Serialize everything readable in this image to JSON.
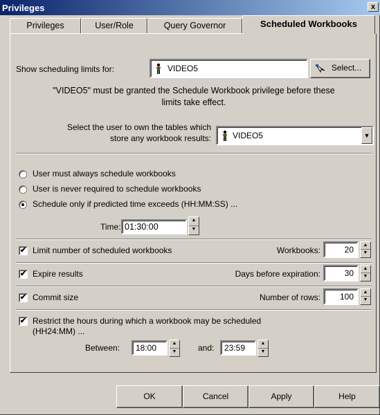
{
  "window": {
    "title": "Privileges",
    "close_glyph": "x"
  },
  "tabs": [
    {
      "label": "Privileges"
    },
    {
      "label": "User/Role"
    },
    {
      "label": "Query Governor"
    },
    {
      "label": "Scheduled Workbooks",
      "active": true
    }
  ],
  "scheduling": {
    "show_limits_label": "Show scheduling limits for:",
    "user_value": "VIDEO5",
    "select_button": "Select...",
    "notice_line1": "\"VIDEO5\" must be granted the Schedule Workbook privilege before these",
    "notice_line2": "limits take effect.",
    "owner_label_line1": "Select the user to own the tables which",
    "owner_label_line2": "store any workbook results:",
    "owner_value": "VIDEO5"
  },
  "options": {
    "radio_always": "User must always schedule workbooks",
    "radio_never": "User is never required to schedule workbooks",
    "radio_exceeds": "Schedule only if predicted time exceeds (HH:MM:SS) ...",
    "selected": "radio_exceeds",
    "time_label": "Time:",
    "time_value": "01:30:00"
  },
  "limits": {
    "limit_label": "Limit number of scheduled workbooks",
    "workbooks_label": "Workbooks:",
    "workbooks_value": "20",
    "expire_label": "Expire results",
    "days_label": "Days before expiration:",
    "days_value": "30",
    "commit_label": "Commit size",
    "rows_label": "Number of rows:",
    "rows_value": "100",
    "restrict_line1": "Restrict the hours during which a workbook may be scheduled",
    "restrict_line2": "(HH24:MM) ...",
    "between_label": "Between:",
    "between_value": "18:00",
    "and_label": "and:",
    "and_value": "23:59"
  },
  "buttons": {
    "ok": "OK",
    "cancel": "Cancel",
    "apply": "Apply",
    "help": "Help"
  }
}
